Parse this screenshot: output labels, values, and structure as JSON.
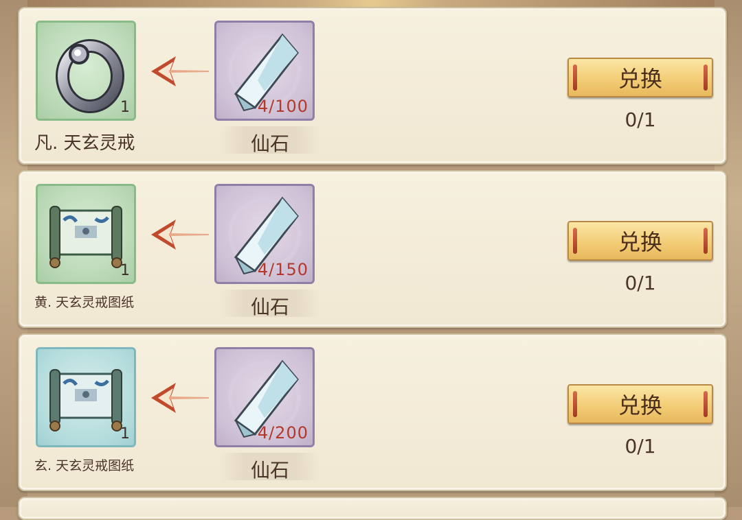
{
  "exchange_items": [
    {
      "reward_name": "凡. 天玄灵戒",
      "reward_icon": "ring-icon",
      "reward_qty": "1",
      "cost_name": "仙石",
      "cost_icon": "crystal-icon",
      "cost_required": "4/100",
      "button_label": "兑换",
      "limit": "0/1"
    },
    {
      "reward_name": "黄. 天玄灵戒图纸",
      "reward_icon": "scroll-icon",
      "reward_qty": "1",
      "cost_name": "仙石",
      "cost_icon": "crystal-icon",
      "cost_required": "4/150",
      "button_label": "兑换",
      "limit": "0/1"
    },
    {
      "reward_name": "玄. 天玄灵戒图纸",
      "reward_icon": "scroll-icon",
      "reward_qty": "1",
      "cost_name": "仙石",
      "cost_icon": "crystal-icon",
      "cost_required": "4/200",
      "button_label": "兑换",
      "limit": "0/1"
    }
  ],
  "colors": {
    "card_bg": "#f3ebd7",
    "button_gold": "#f3cd77",
    "cost_text": "#b33a2a",
    "reward_green": "#b9d8b5",
    "reward_cyan": "#b4dcdc",
    "cost_purple": "#cfc1d6"
  }
}
